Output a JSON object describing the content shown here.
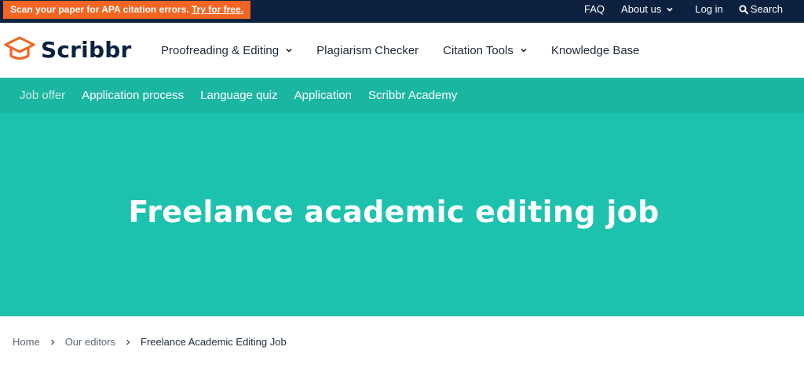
{
  "promo": {
    "text": "Scan your paper for APA citation errors.",
    "link": "Try for free."
  },
  "topnav": {
    "faq": "FAQ",
    "about": "About us",
    "login": "Log in",
    "search": "Search"
  },
  "logo": {
    "word": "Scribbr"
  },
  "mainnav": {
    "proofreading": "Proofreading & Editing",
    "plagiarism": "Plagiarism Checker",
    "citation": "Citation Tools",
    "knowledge": "Knowledge Base"
  },
  "subnav": [
    "Job offer",
    "Application process",
    "Language quiz",
    "Application",
    "Scribbr Academy"
  ],
  "hero": {
    "title": "Freelance academic editing job"
  },
  "breadcrumb": {
    "home": "Home",
    "editors": "Our editors",
    "current": "Freelance Academic Editing Job"
  },
  "colors": {
    "navy": "#0a2240",
    "orange": "#f26522",
    "teal": "#1dc2ae",
    "teal_dark": "#1bb6a2"
  },
  "icons": [
    "chevron-down-icon",
    "search-icon",
    "graduation-cap-logo-icon",
    "chevron-right-icon"
  ]
}
